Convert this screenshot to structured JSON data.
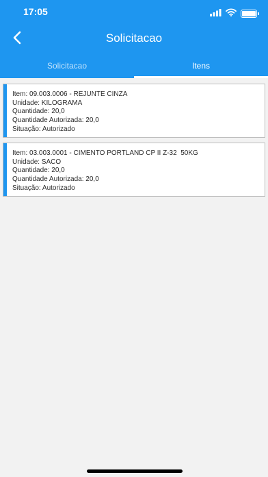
{
  "status_bar": {
    "time": "17:05"
  },
  "nav": {
    "title": "Solicitacao"
  },
  "tabs": [
    {
      "label": "Solicitacao",
      "active": false
    },
    {
      "label": "Itens",
      "active": true
    }
  ],
  "items": [
    {
      "item": "Item: 09.003.0006 - REJUNTE CINZA",
      "unidade": "Unidade: KILOGRAMA",
      "quantidade": "Quantidade: 20,0",
      "quantidade_autorizada": "Quantidade Autorizada: 20,0",
      "situacao": "Situação: Autorizado"
    },
    {
      "item": "Item: 03.003.0001 - CIMENTO PORTLAND CP II Z-32  50KG",
      "unidade": "Unidade: SACO",
      "quantidade": "Quantidade: 20,0",
      "quantidade_autorizada": "Quantidade Autorizada: 20,0",
      "situacao": "Situação: Autorizado"
    }
  ],
  "colors": {
    "primary": "#1e96f0",
    "background": "#f2f2f2",
    "card_border": "#bdbdbd"
  }
}
